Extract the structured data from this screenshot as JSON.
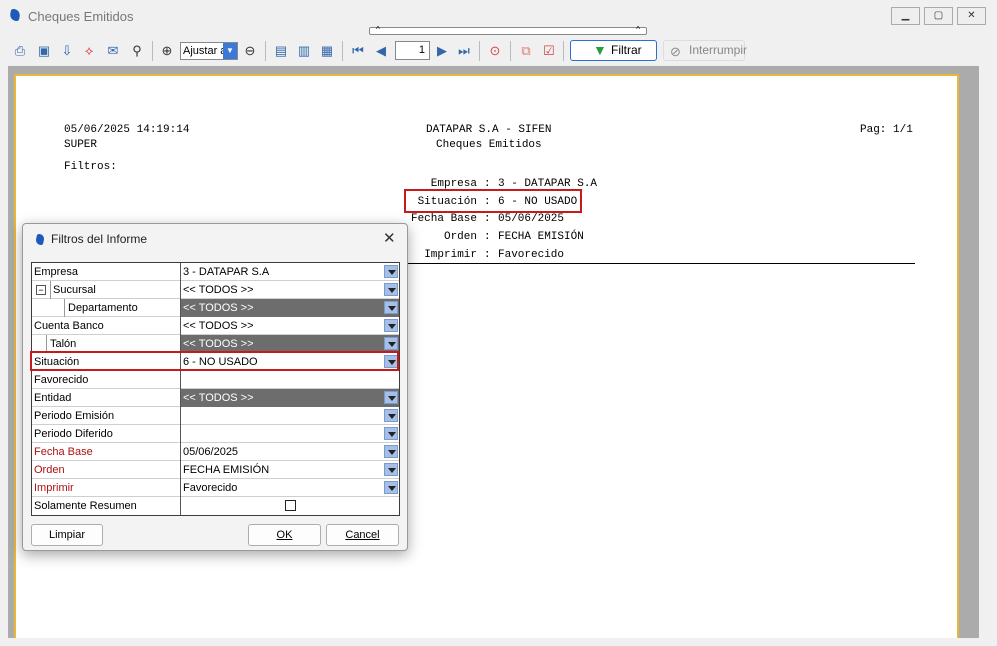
{
  "window": {
    "title": "Cheques Emitidos"
  },
  "toolbar": {
    "zoom_value": "Ajustar a",
    "page_number": "1",
    "filter_label": "Filtrar",
    "interrupt_label": "Interrumpir"
  },
  "report": {
    "datetime": "05/06/2025 14:19:14",
    "user": "SUPER",
    "filters_label": "Filtros:",
    "company_header": "DATAPAR S.A - SIFEN",
    "report_title": "Cheques Emitidos",
    "page_label": "Pag: 1/1",
    "params": [
      {
        "label": "Empresa",
        "value": "3 - DATAPAR S.A"
      },
      {
        "label": "Situación",
        "value": "6 - NO USADO"
      },
      {
        "label": "Fecha Base",
        "value": "05/06/2025"
      },
      {
        "label": "Orden",
        "value": "FECHA EMISIÓN"
      },
      {
        "label": "Imprimir",
        "value": "Favorecido"
      }
    ]
  },
  "dialog": {
    "title": "Filtros del Informe",
    "rows": [
      {
        "label": "Empresa",
        "value": "3 - DATAPAR S.A"
      },
      {
        "label": "Sucursal",
        "value": "<< TODOS >>",
        "expander": "−"
      },
      {
        "label": "Departamento",
        "value": "<< TODOS >>"
      },
      {
        "label": "Cuenta Banco",
        "value": "<< TODOS >>"
      },
      {
        "label": "Talón",
        "value": "<< TODOS >>"
      },
      {
        "label": "Situación",
        "value": "6 - NO USADO"
      },
      {
        "label": "Favorecido",
        "value": ""
      },
      {
        "label": "Entidad",
        "value": "<< TODOS >>"
      },
      {
        "label": "Periodo Emisión",
        "value": ""
      },
      {
        "label": "Periodo Diferido",
        "value": ""
      },
      {
        "label": "Fecha Base",
        "value": "05/06/2025"
      },
      {
        "label": "Orden",
        "value": "FECHA EMISIÓN"
      },
      {
        "label": "Imprimir",
        "value": "Favorecido"
      },
      {
        "label": "Solamente Resumen",
        "value": ""
      }
    ],
    "clear_label": "Limpiar",
    "ok_label": "OK",
    "cancel_label": "Cancel"
  },
  "colors": {
    "highlight": "#c81a1a",
    "required_label": "#b01010",
    "page_border": "#e8b83a",
    "dropdown": "#a6bfe6",
    "disabled_value_bg": "#6d6d6d"
  }
}
